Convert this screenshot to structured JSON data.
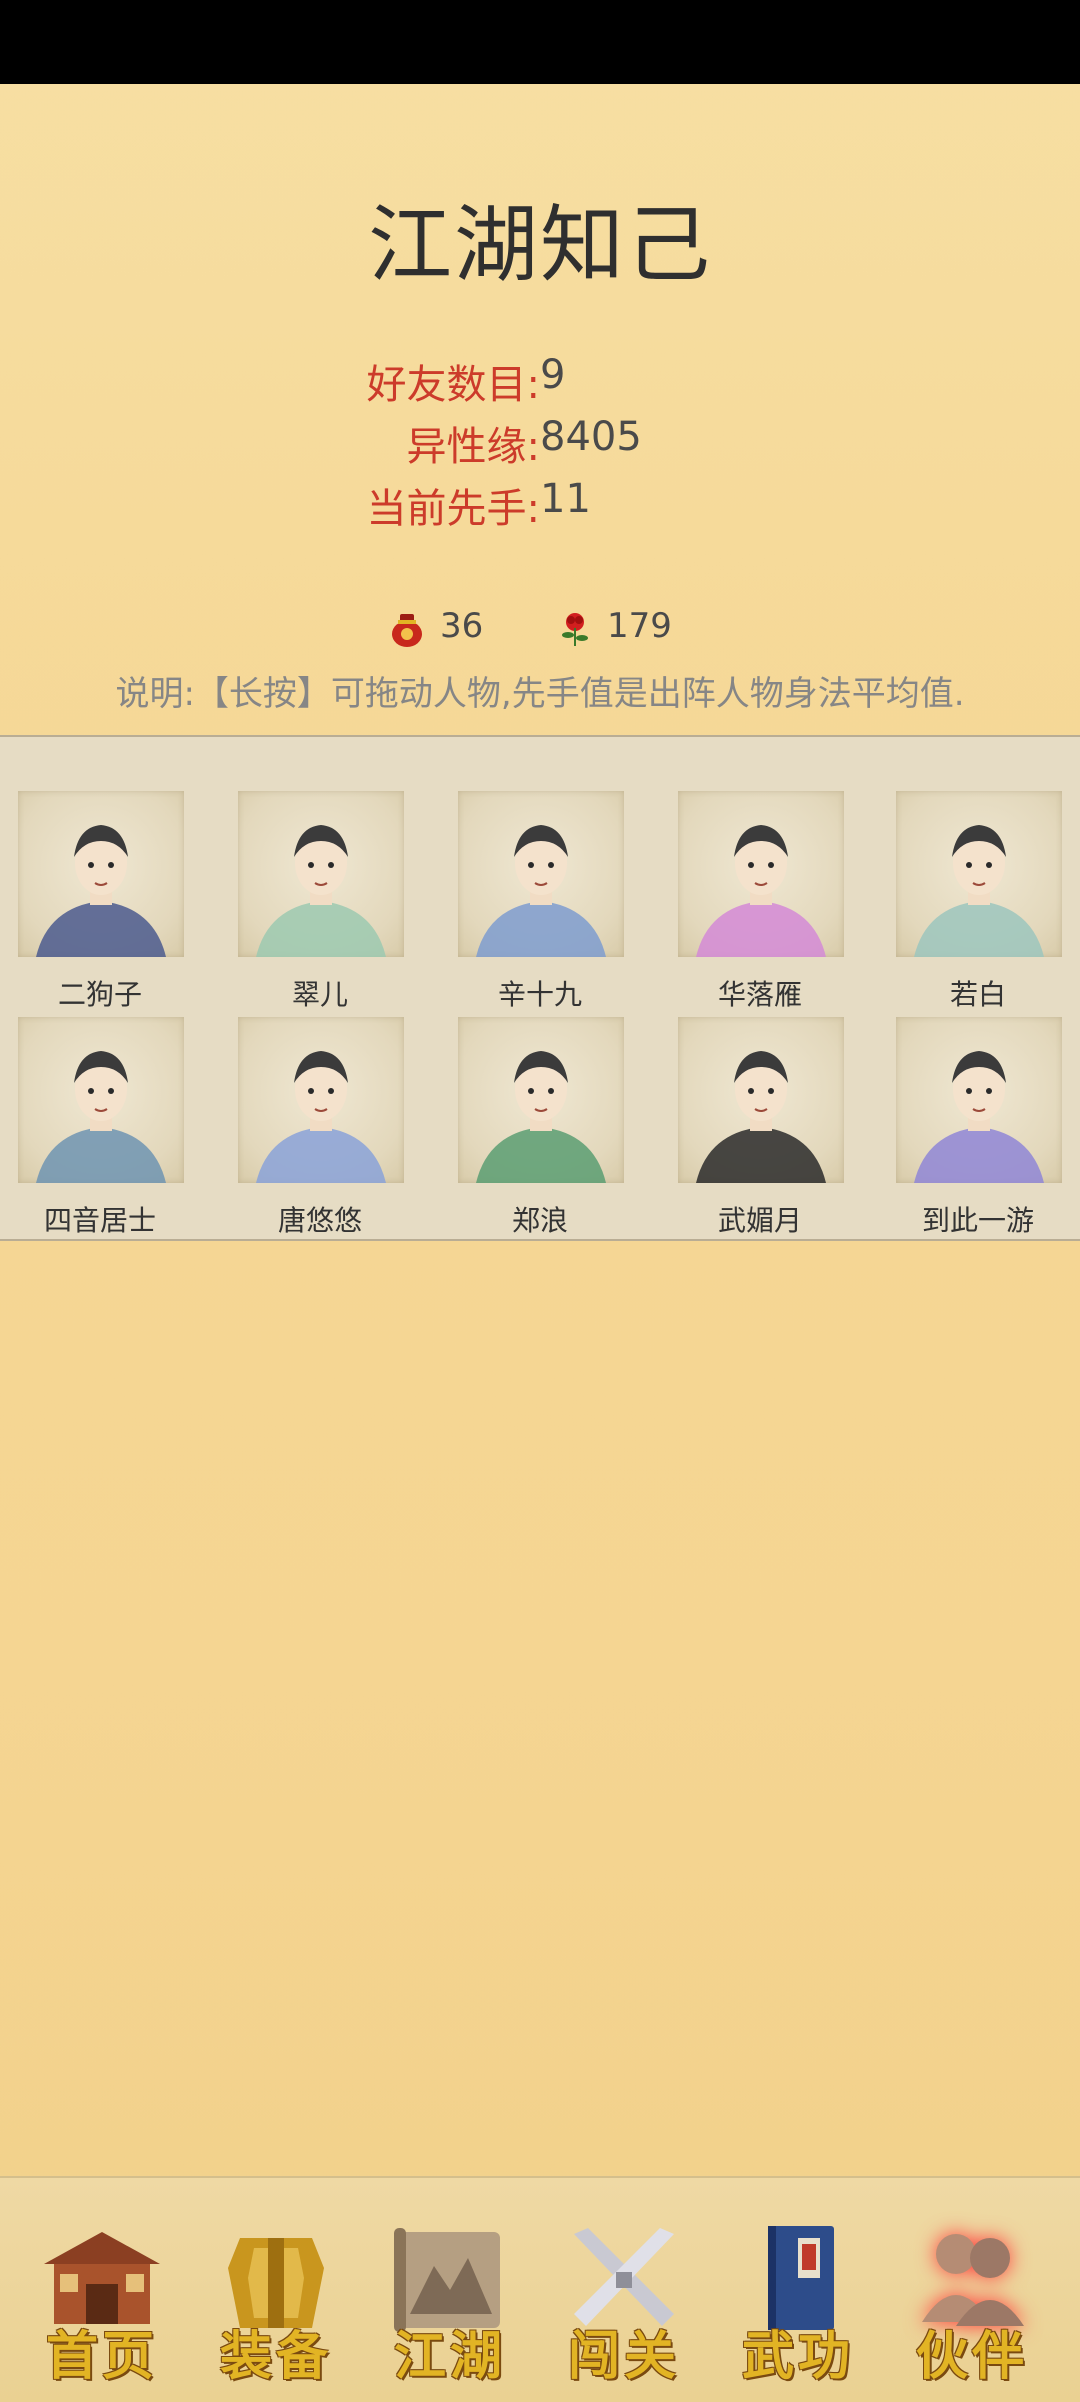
{
  "page": {
    "title": "江湖知己"
  },
  "stats": [
    {
      "label": "好友数目:",
      "value": "9"
    },
    {
      "label": "异性缘:",
      "value": "8405"
    },
    {
      "label": "当前先手:",
      "value": "11"
    }
  ],
  "resources": {
    "wine": {
      "icon": "wine-jar-icon",
      "value": "36"
    },
    "rose": {
      "icon": "rose-icon",
      "value": "179"
    }
  },
  "explanation": "说明:【长按】可拖动人物,先手值是出阵人物身法平均值.",
  "characters": [
    {
      "name": "二狗子",
      "robe": "#4b5a8e"
    },
    {
      "name": "翠儿",
      "robe": "#9cc9b0"
    },
    {
      "name": "辛十九",
      "robe": "#7e9ccf"
    },
    {
      "name": "华落雁",
      "robe": "#d38ad6"
    },
    {
      "name": "若白",
      "robe": "#9cc6bd"
    },
    {
      "name": "四音居士",
      "robe": "#6e94b2"
    },
    {
      "name": "唐悠悠",
      "robe": "#8aa2d8"
    },
    {
      "name": "郑浪",
      "robe": "#5a9e72"
    },
    {
      "name": "武媚月",
      "robe": "#2a2a2a"
    },
    {
      "name": "到此一游",
      "robe": "#8f86d6"
    }
  ],
  "nav": [
    {
      "label": "首页",
      "icon": "house-icon",
      "active": false
    },
    {
      "label": "装备",
      "icon": "armor-icon",
      "active": false
    },
    {
      "label": "江湖",
      "icon": "scroll-map-icon",
      "active": false
    },
    {
      "label": "闯关",
      "icon": "crossed-swords-icon",
      "active": false
    },
    {
      "label": "武功",
      "icon": "book-icon",
      "active": false
    },
    {
      "label": "伙伴",
      "icon": "partners-icon",
      "active": true
    }
  ]
}
